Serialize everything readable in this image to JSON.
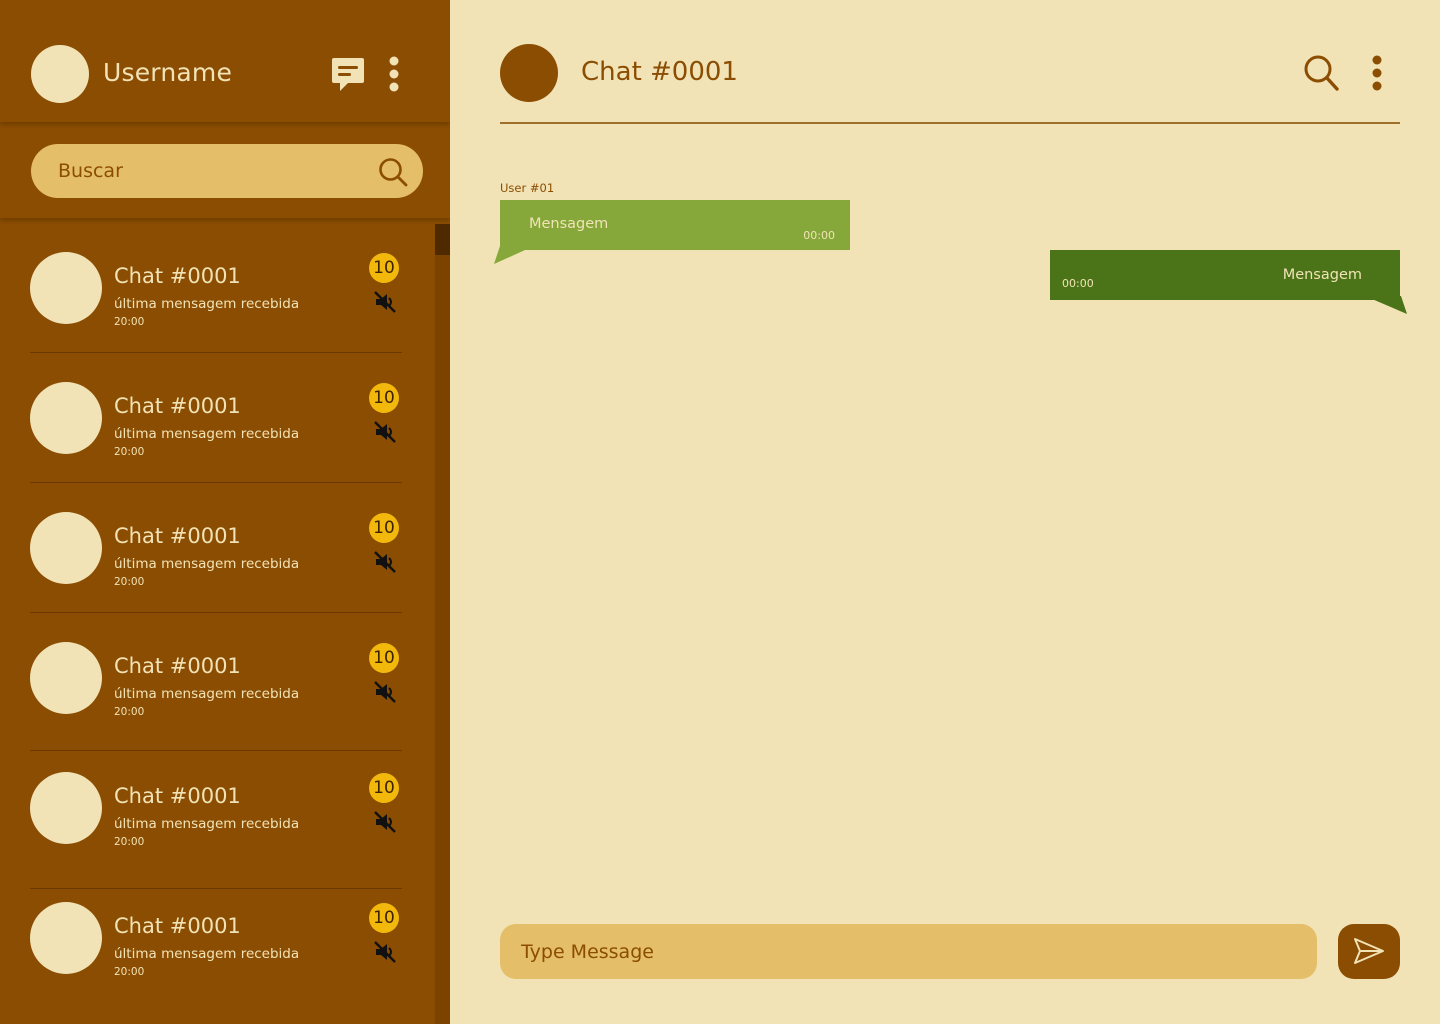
{
  "colors": {
    "sidebar_bg": "#8B4D02",
    "main_bg": "#F1E3B6",
    "input_bg": "#E5BE69",
    "badge": "#F2B90C",
    "incoming_bubble": "#86A83A",
    "outgoing_bubble": "#4B7318"
  },
  "sidebar": {
    "username": "Username",
    "search_placeholder": "Buscar",
    "chats": [
      {
        "title": "Chat #0001",
        "last_message": "última mensagem recebida",
        "time": "20:00",
        "unread": "10"
      },
      {
        "title": "Chat #0001",
        "last_message": "última mensagem recebida",
        "time": "20:00",
        "unread": "10"
      },
      {
        "title": "Chat #0001",
        "last_message": "última mensagem recebida",
        "time": "20:00",
        "unread": "10"
      },
      {
        "title": "Chat #0001",
        "last_message": "última mensagem recebida",
        "time": "20:00",
        "unread": "10"
      },
      {
        "title": "Chat #0001",
        "last_message": "última mensagem recebida",
        "time": "20:00",
        "unread": "10"
      },
      {
        "title": "Chat #0001",
        "last_message": "última mensagem recebida",
        "time": "20:00",
        "unread": "10"
      }
    ]
  },
  "main": {
    "chat_name": "Chat #0001",
    "messages": [
      {
        "sender": "User #01",
        "text": "Mensagem",
        "time": "00:00",
        "direction": "incoming"
      },
      {
        "text": "Mensagem",
        "time": "00:00",
        "direction": "outgoing"
      }
    ],
    "input_placeholder": "Type Message"
  },
  "icons": {
    "new_chat": "chat-bubble-icon",
    "more": "kebab-menu-icon",
    "search": "search-icon",
    "muted": "speaker-muted-icon",
    "send": "send-icon"
  }
}
